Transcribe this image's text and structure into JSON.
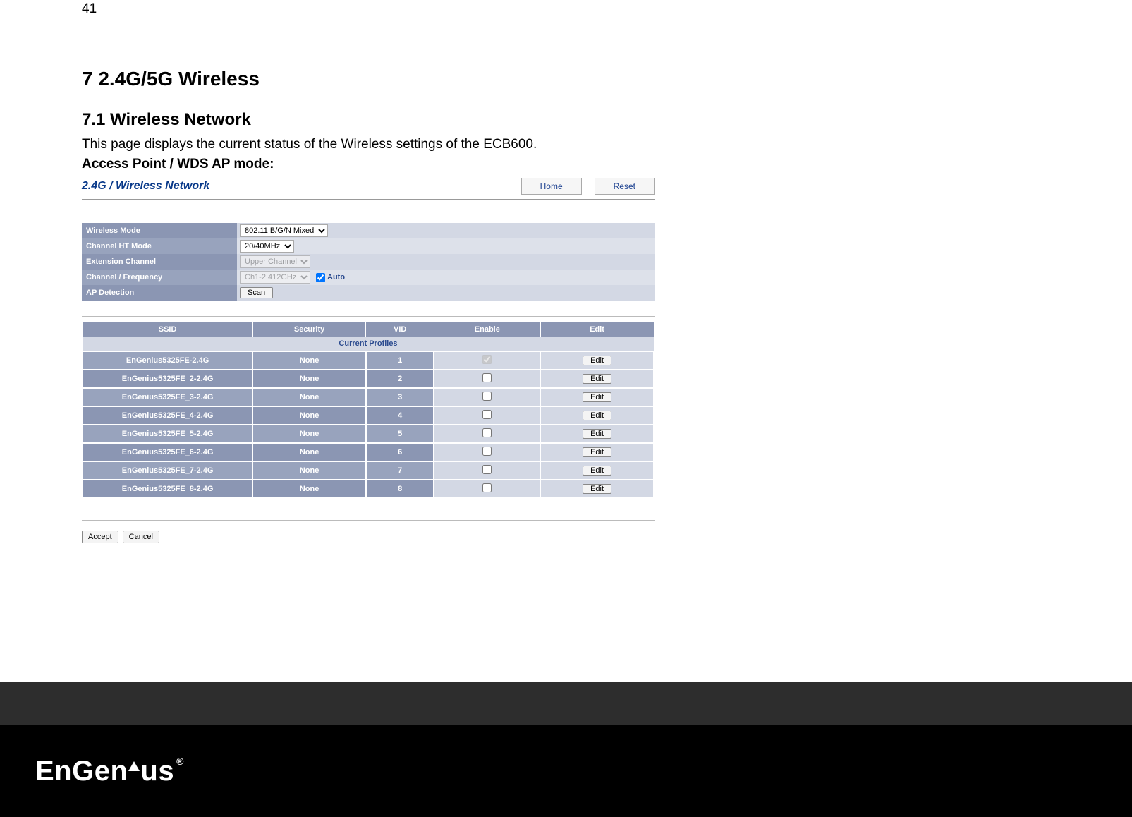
{
  "page_number": "41",
  "heading1": "7  2.4G/5G Wireless",
  "heading2": "7.1   Wireless Network",
  "intro": "This page displays the current status of the Wireless settings of the ECB600.",
  "subhead": "Access Point / WDS AP mode:",
  "panel": {
    "title": "2.4G / Wireless Network",
    "home_label": "Home",
    "reset_label": "Reset"
  },
  "settings": {
    "wireless_mode_label": "Wireless Mode",
    "wireless_mode_value": "802.11 B/G/N Mixed",
    "channel_ht_label": "Channel HT Mode",
    "channel_ht_value": "20/40MHz",
    "ext_channel_label": "Extension Channel",
    "ext_channel_value": "Upper Channel",
    "channel_freq_label": "Channel / Frequency",
    "channel_freq_value": "Ch1-2.412GHz",
    "auto_label": "Auto",
    "ap_detection_label": "AP Detection",
    "scan_label": "Scan"
  },
  "profiles": {
    "title": "Current Profiles",
    "col_ssid": "SSID",
    "col_security": "Security",
    "col_vid": "VID",
    "col_enable": "Enable",
    "col_edit": "Edit",
    "edit_label": "Edit",
    "rows": [
      {
        "ssid": "EnGenius5325FE-2.4G",
        "security": "None",
        "vid": "1",
        "enabled": true
      },
      {
        "ssid": "EnGenius5325FE_2-2.4G",
        "security": "None",
        "vid": "2",
        "enabled": false
      },
      {
        "ssid": "EnGenius5325FE_3-2.4G",
        "security": "None",
        "vid": "3",
        "enabled": false
      },
      {
        "ssid": "EnGenius5325FE_4-2.4G",
        "security": "None",
        "vid": "4",
        "enabled": false
      },
      {
        "ssid": "EnGenius5325FE_5-2.4G",
        "security": "None",
        "vid": "5",
        "enabled": false
      },
      {
        "ssid": "EnGenius5325FE_6-2.4G",
        "security": "None",
        "vid": "6",
        "enabled": false
      },
      {
        "ssid": "EnGenius5325FE_7-2.4G",
        "security": "None",
        "vid": "7",
        "enabled": false
      },
      {
        "ssid": "EnGenius5325FE_8-2.4G",
        "security": "None",
        "vid": "8",
        "enabled": false
      }
    ]
  },
  "bottom": {
    "accept_label": "Accept",
    "cancel_label": "Cancel"
  },
  "logo": {
    "part1": "EnGen",
    "part2": "us",
    "reg": "®"
  }
}
